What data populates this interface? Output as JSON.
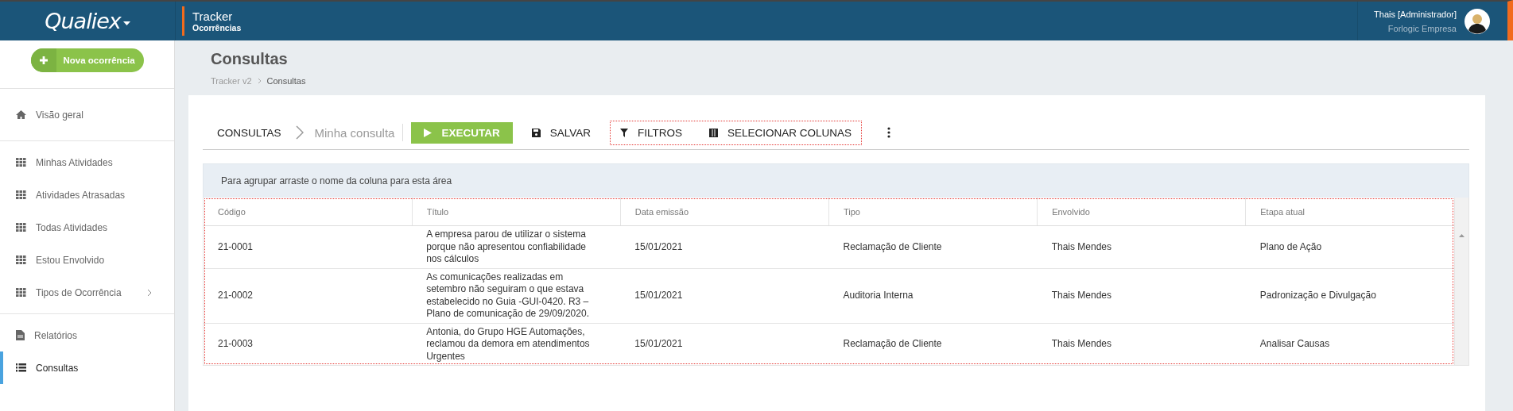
{
  "header": {
    "logo": "Qualiex",
    "module_title": "Tracker",
    "module_subtitle": "Ocorrências",
    "user_name": "Thais [Administrador]",
    "company": "Forlogic Empresa"
  },
  "sidebar": {
    "new_button": "Nova ocorrência",
    "sections": [
      [
        {
          "label": "Visão geral",
          "kind": "home",
          "selected": false,
          "has_submenu": false
        }
      ],
      [
        {
          "label": "Minhas Atividades",
          "kind": "grid",
          "selected": false,
          "has_submenu": false
        },
        {
          "label": "Atividades Atrasadas",
          "kind": "grid",
          "selected": false,
          "has_submenu": false
        },
        {
          "label": "Todas Atividades",
          "kind": "grid",
          "selected": false,
          "has_submenu": false
        },
        {
          "label": "Estou Envolvido",
          "kind": "grid",
          "selected": false,
          "has_submenu": false
        },
        {
          "label": "Tipos de Ocorrência",
          "kind": "grid",
          "selected": false,
          "has_submenu": true
        }
      ],
      [
        {
          "label": "Relatórios",
          "kind": "file",
          "selected": false,
          "has_submenu": false
        },
        {
          "label": "Consultas",
          "kind": "list",
          "selected": true,
          "has_submenu": false
        }
      ]
    ]
  },
  "page": {
    "title": "Consultas",
    "breadcrumb": [
      "Tracker v2",
      "Consultas"
    ]
  },
  "toolbar": {
    "root": "CONSULTAS",
    "query_name": "Minha consulta",
    "run": "EXECUTAR",
    "save": "SALVAR",
    "filters": "FILTROS",
    "select_columns": "SELECIONAR COLUNAS"
  },
  "group_panel": {
    "text": "Para agrupar arraste o nome da coluna para esta área"
  },
  "table": {
    "columns": [
      "Código",
      "Título",
      "Data emissão",
      "Tipo",
      "Envolvido",
      "Etapa atual"
    ],
    "rows": [
      [
        "21-0001",
        "A empresa parou de utilizar o sistema porque não apresentou confiabilidade nos cálculos",
        "15/01/2021",
        "Reclamação de Cliente",
        "Thais Mendes",
        "Plano de Ação"
      ],
      [
        "21-0002",
        "As comunicações realizadas em setembro não seguiram o que estava estabelecido no Guia -GUI-0420. R3 – Plano de comunicação de 29/09/2020.",
        "15/01/2021",
        "Auditoria Interna",
        "Thais Mendes",
        "Padronização e Divulgação"
      ],
      [
        "21-0003",
        "Antonia, do Grupo HGE Automações, reclamou da demora em atendimentos Urgentes",
        "15/01/2021",
        "Reclamação de Cliente",
        "Thais Mendes",
        "Analisar Causas"
      ]
    ]
  }
}
